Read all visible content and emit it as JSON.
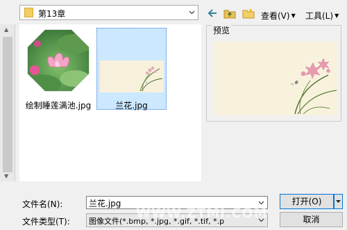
{
  "toolbar": {
    "look_in_folder": "第13章",
    "view_menu": "查看(V)",
    "tools_menu": "工具(L)"
  },
  "files": [
    {
      "name": "绘制睡莲满池.jpg",
      "selected": false,
      "icon": "lotus-thumbnail"
    },
    {
      "name": "兰花.jpg",
      "selected": true,
      "icon": "orchid-thumbnail"
    }
  ],
  "preview": {
    "title": "预览"
  },
  "form": {
    "filename_label": "文件名(N):",
    "filename_value": "兰花.jpg",
    "filetype_label": "文件类型(T):",
    "filetype_value": "图像文件(*.bmp, *.jpg, *.gif, *.tif, *.p"
  },
  "buttons": {
    "open": "打开(O)",
    "cancel": "取消"
  },
  "watermark": "WWW.ZTMI.COM",
  "colors": {
    "selection": "#cce8ff",
    "accent": "#0078d7"
  }
}
